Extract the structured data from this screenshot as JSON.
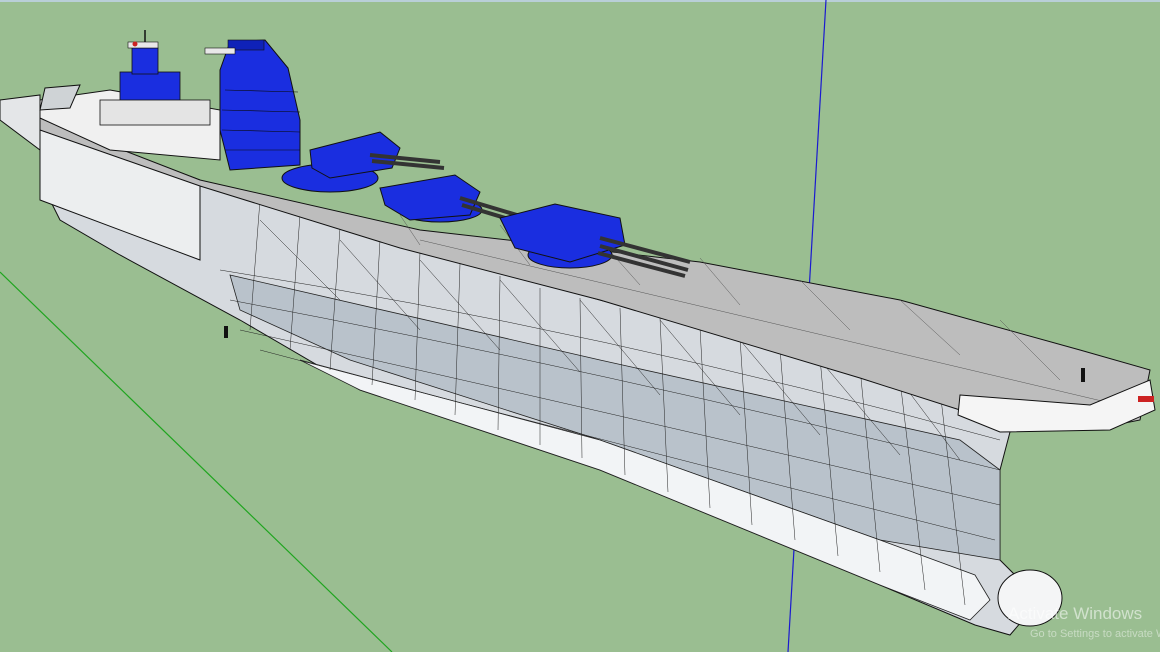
{
  "app": {
    "name": "3D modeling viewport"
  },
  "viewport": {
    "background": "#9abe91",
    "axis_colors": {
      "blue_axis": "#1a1ad0",
      "green_axis": "#1fa51f"
    },
    "model_colors": {
      "hull_light": "#dcdfe3",
      "hull_shade": "#b8c0c8",
      "deck": "#b9b9b9",
      "superstructure": "#1a2ee0",
      "edges": "#111111"
    }
  },
  "watermark": {
    "title": "Activate Windows",
    "subtitle": "Go to Settings to activate Windows."
  }
}
